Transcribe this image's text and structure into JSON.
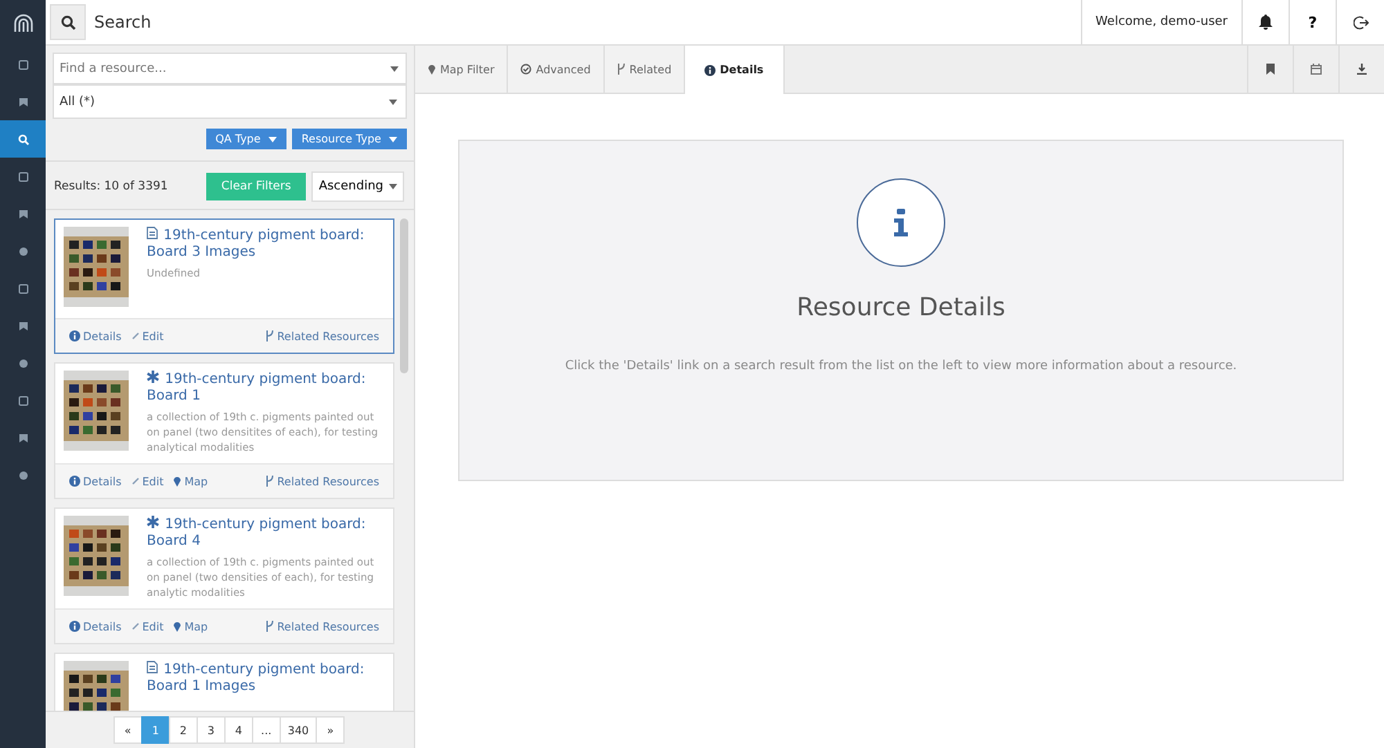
{
  "header": {
    "search_label": "Search",
    "welcome": "Welcome, demo-user",
    "help": "?"
  },
  "sidebar": {
    "items": [
      {
        "selected": false
      },
      {
        "selected": false
      },
      {
        "selected": true
      },
      {
        "selected": false
      },
      {
        "selected": false
      },
      {
        "selected": false
      },
      {
        "selected": false
      },
      {
        "selected": false
      },
      {
        "selected": false
      },
      {
        "selected": false
      },
      {
        "selected": false
      },
      {
        "selected": false
      }
    ]
  },
  "filters": {
    "search": {
      "placeholder": "Find a resource..."
    },
    "scope": "All (*)",
    "buttons": [
      "QA Type",
      "Resource Type"
    ]
  },
  "results": {
    "count": "Results: 10 of 3391",
    "clear": "Clear Filters",
    "sort": "Ascending",
    "items": [
      {
        "kind": "file",
        "title": "19th-century pigment board: Board 3 Images",
        "description": "Undefined",
        "selected": true,
        "links": [
          "Details",
          "Edit",
          "Related Resources"
        ]
      },
      {
        "kind": "asterisk",
        "title": "19th-century pigment board: Board 1",
        "description": "a collection of 19th c. pigments painted out on panel (two densitites of each), for testing analytical modalities",
        "selected": false,
        "links": [
          "Details",
          "Edit",
          "Map",
          "Related Resources"
        ]
      },
      {
        "kind": "asterisk",
        "title": "19th-century pigment board: Board 4",
        "description": "a collection of 19th c. pigments painted out on panel (two densities of each), for testing analytic modalities",
        "selected": false,
        "links": [
          "Details",
          "Edit",
          "Map",
          "Related Resources"
        ]
      },
      {
        "kind": "file",
        "title": "19th-century pigment board: Board 1 Images",
        "selected": false
      }
    ]
  },
  "pagination": [
    {
      "label": "«",
      "selected": false
    },
    {
      "label": "1",
      "selected": true
    },
    {
      "label": "2",
      "selected": false
    },
    {
      "label": "3",
      "selected": false
    },
    {
      "label": "4",
      "selected": false
    },
    {
      "label": "...",
      "selected": false
    },
    {
      "label": "340",
      "selected": false
    },
    {
      "label": "»",
      "selected": false
    }
  ],
  "tabs": [
    {
      "label": "Map Filter",
      "selected": false
    },
    {
      "label": "Advanced",
      "selected": false
    },
    {
      "label": "Related",
      "selected": false
    },
    {
      "label": "Details",
      "selected": true
    }
  ],
  "details": {
    "title": "Resource Details",
    "message": "Click the 'Details' link on a search result from the list on the left to view more information about a resource."
  }
}
